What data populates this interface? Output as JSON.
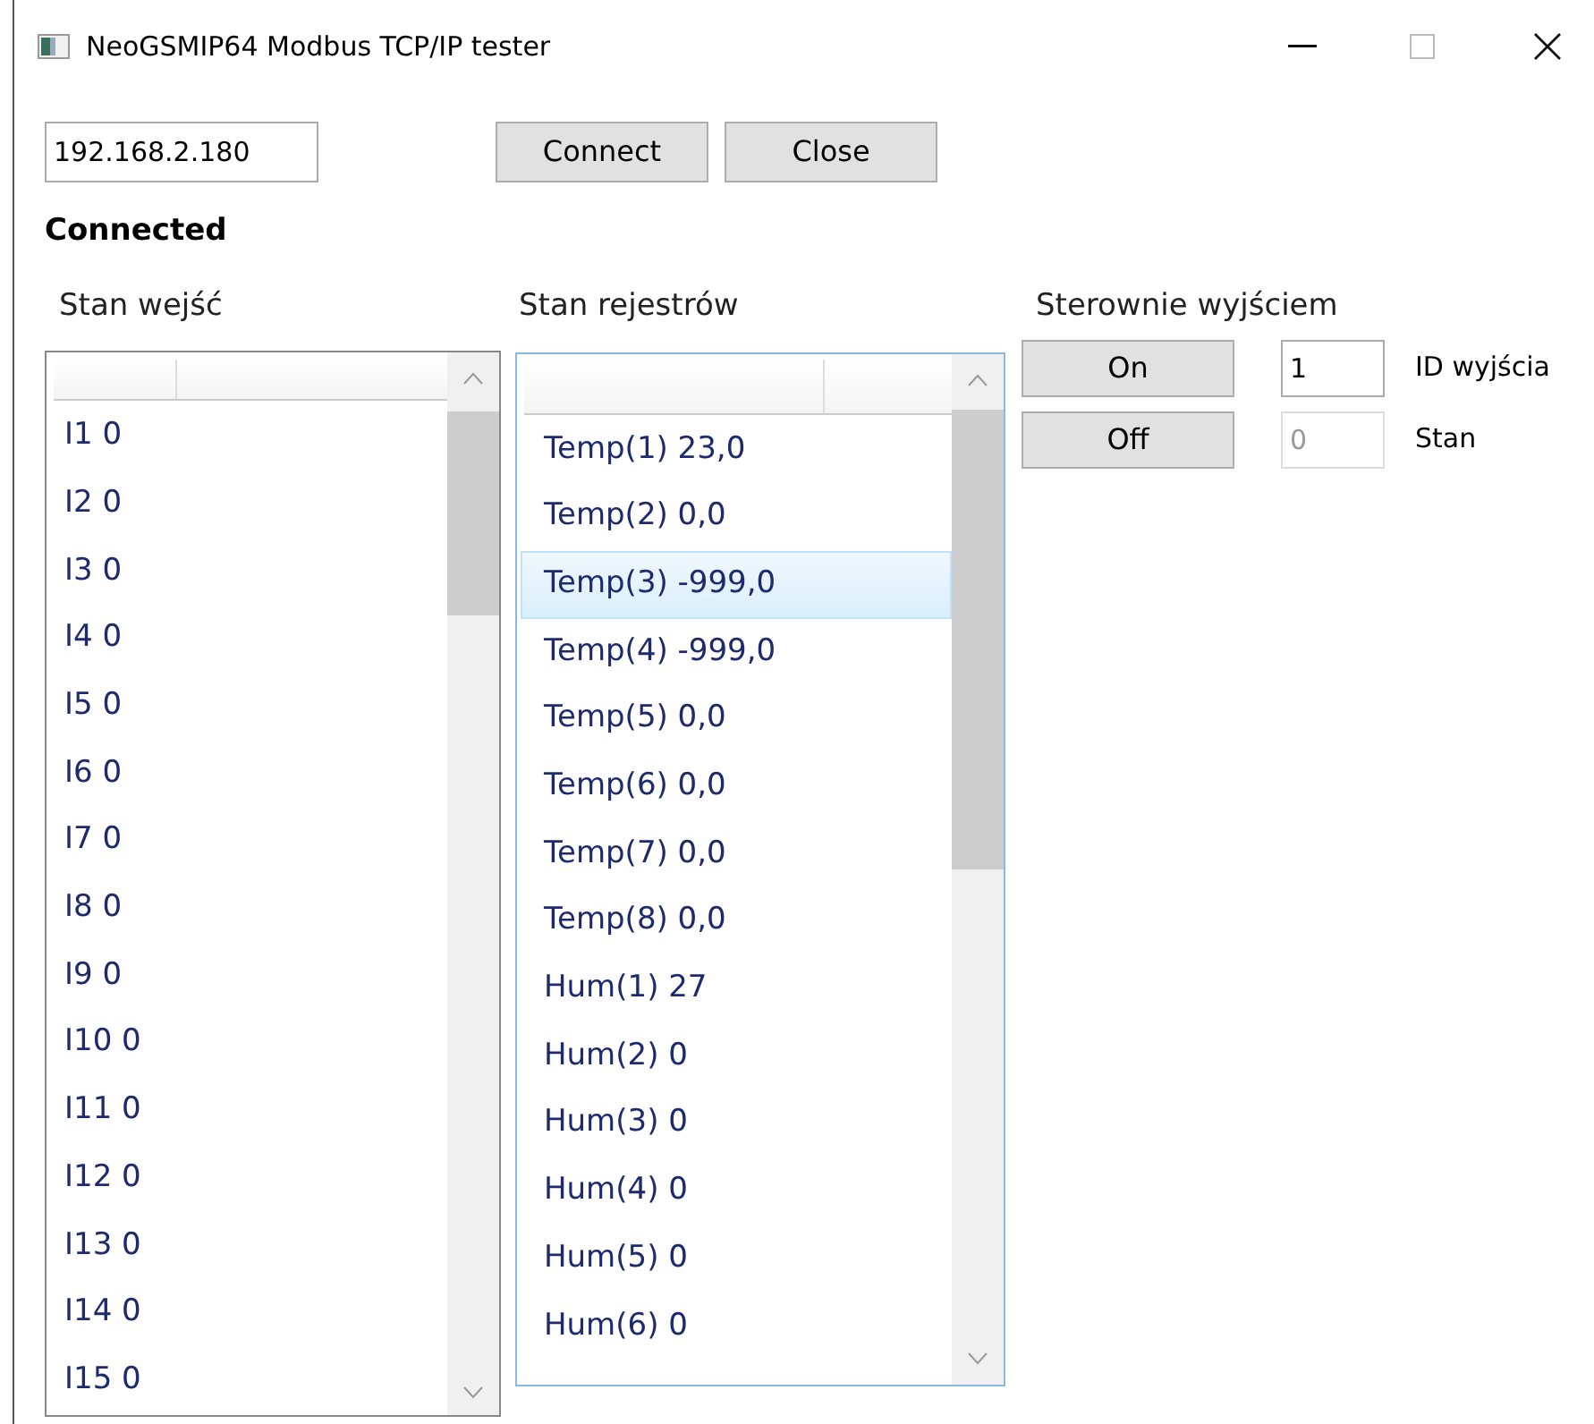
{
  "window": {
    "title": "NeoGSMIP64 Modbus TCP/IP tester"
  },
  "connection": {
    "address": "192.168.2.180",
    "buttons": [
      "Connect",
      "Close"
    ],
    "status": "Connected"
  },
  "inputs": {
    "heading": "Stan wejść",
    "items": [
      "I1 0",
      "I2 0",
      "I3 0",
      "I4 0",
      "I5 0",
      "I6 0",
      "I7 0",
      "I8 0",
      "I9 0",
      "I10 0",
      "I11 0",
      "I12 0",
      "I13 0",
      "I14 0",
      "I15 0"
    ]
  },
  "registers": {
    "heading": "Stan rejestrów",
    "items": [
      {
        "text": "Temp(1) 23,0",
        "selected": false
      },
      {
        "text": "Temp(2) 0,0",
        "selected": false
      },
      {
        "text": "Temp(3) -999,0",
        "selected": true
      },
      {
        "text": "Temp(4) -999,0",
        "selected": false
      },
      {
        "text": "Temp(5) 0,0",
        "selected": false
      },
      {
        "text": "Temp(6) 0,0",
        "selected": false
      },
      {
        "text": "Temp(7) 0,0",
        "selected": false
      },
      {
        "text": "Temp(8) 0,0",
        "selected": false
      },
      {
        "text": "Hum(1) 27",
        "selected": false
      },
      {
        "text": "Hum(2) 0",
        "selected": false
      },
      {
        "text": "Hum(3) 0",
        "selected": false
      },
      {
        "text": "Hum(4) 0",
        "selected": false
      },
      {
        "text": "Hum(5) 0",
        "selected": false
      },
      {
        "text": "Hum(6) 0",
        "selected": false
      }
    ]
  },
  "output_control": {
    "heading": "Sterownie wyjściem",
    "rows": [
      {
        "button": "On",
        "value": "1",
        "disabled": false,
        "label": "ID wyjścia"
      },
      {
        "button": "Off",
        "value": "0",
        "disabled": true,
        "label": "Stan"
      }
    ]
  }
}
